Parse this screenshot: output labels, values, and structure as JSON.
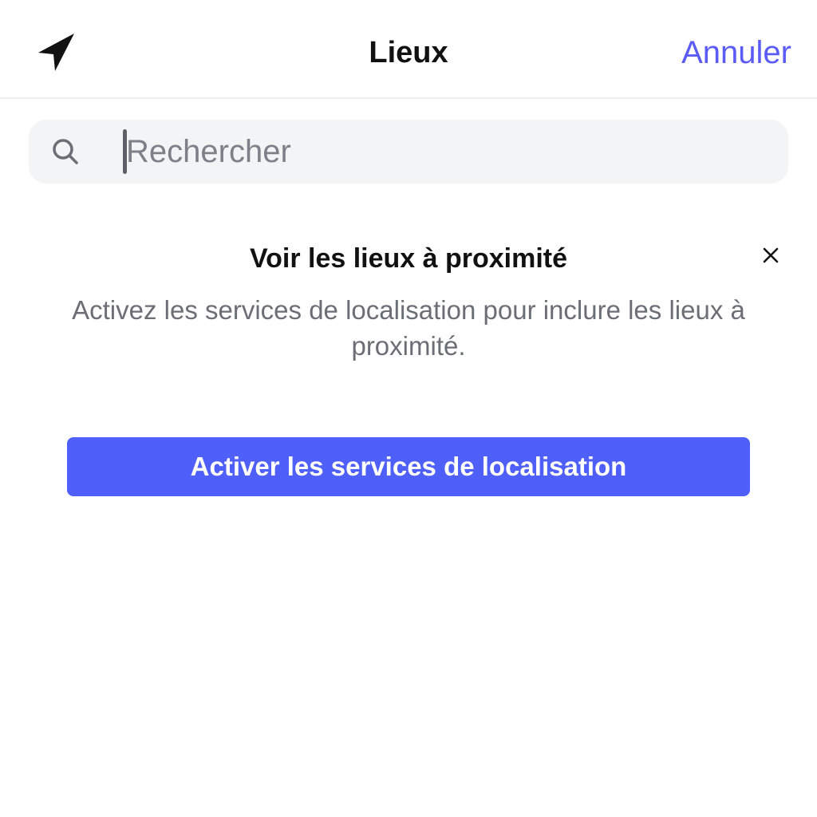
{
  "header": {
    "title": "Lieux",
    "cancel_label": "Annuler",
    "location_icon": "navigation-arrow-icon"
  },
  "search": {
    "placeholder": "Rechercher",
    "value": "",
    "icon": "search-icon"
  },
  "prompt": {
    "title": "Voir les lieux à proximité",
    "body": "Activez les services de localisation pour inclure les lieux à proximité.",
    "dismiss_icon": "close-icon",
    "button_label": "Activer les services de localisation"
  },
  "colors": {
    "accent": "#5b5bf5",
    "button_bg": "#4f5ffa",
    "search_bg": "#f3f4f6",
    "muted_text": "#6b6e75"
  }
}
